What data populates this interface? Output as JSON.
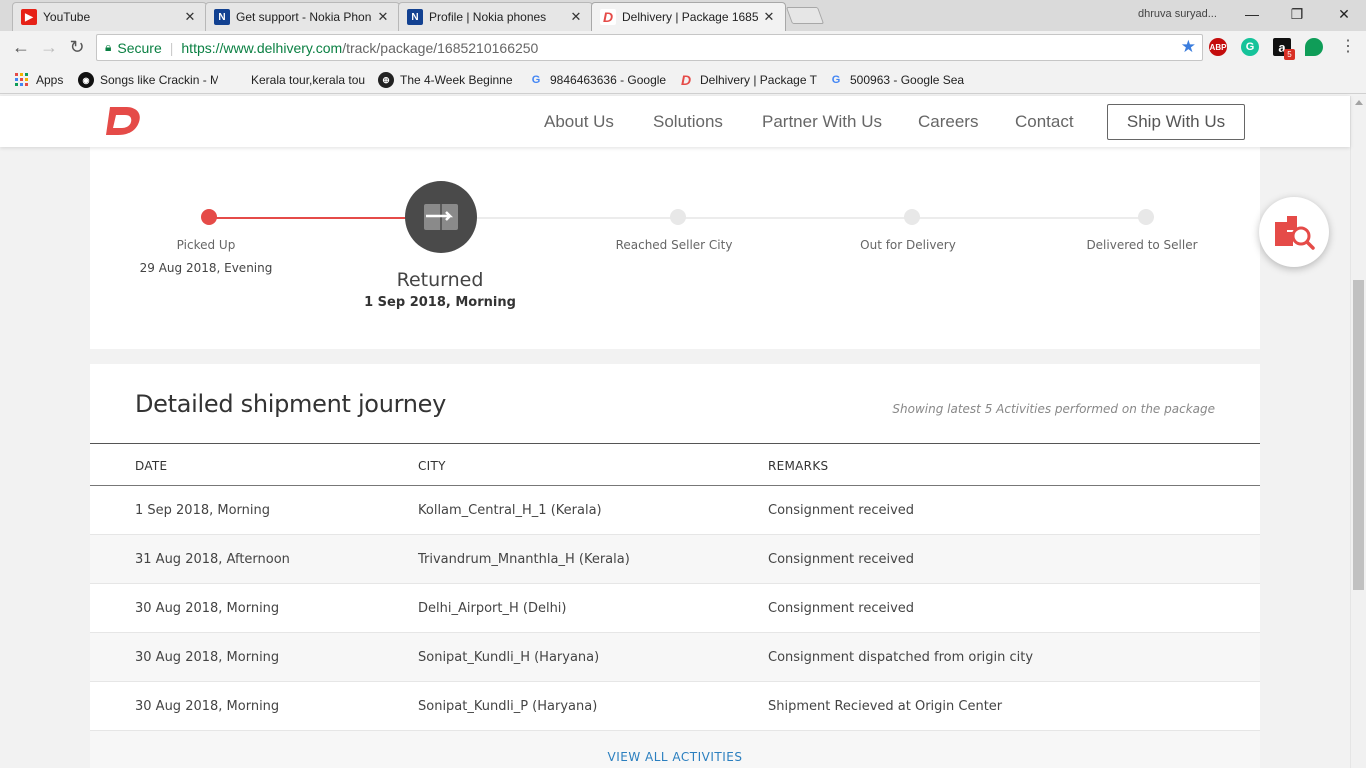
{
  "browser": {
    "tabs": [
      {
        "title": "YouTube",
        "icon": "youtube-icon",
        "color": "#e62117"
      },
      {
        "title": "Get support - Nokia Phon",
        "icon": "nokia-icon",
        "color": "#124191"
      },
      {
        "title": "Profile | Nokia phones",
        "icon": "nokia-icon",
        "color": "#124191"
      },
      {
        "title": "Delhivery | Package 1685",
        "icon": "delhivery-icon",
        "color": "#e54b48"
      }
    ],
    "profile_name": "dhruva suryad...",
    "address": {
      "secure_label": "Secure",
      "url_host": "https://www.delhivery.com",
      "url_path": "/track/package/1685210166250"
    },
    "extensions": [
      {
        "name": "adblock-icon",
        "label": "ABP",
        "color": "#c40d0d"
      },
      {
        "name": "grammarly-icon",
        "label": "G",
        "color": "#15c39a"
      },
      {
        "name": "amazon-icon",
        "label": "a",
        "color": "#111111",
        "badge": "5"
      },
      {
        "name": "hangouts-icon",
        "label": "",
        "color": "#0f9d58"
      }
    ],
    "bookmarks": [
      {
        "label": "Apps",
        "icon": "apps-grid-icon"
      },
      {
        "label": "Songs like Crackin - M",
        "icon": "music-icon"
      },
      {
        "label": "Kerala tour,kerala tou",
        "icon": "blank-page-icon"
      },
      {
        "label": "The 4-Week Beginne",
        "icon": "fitness-icon"
      },
      {
        "label": "9846463636 - Google",
        "icon": "google-icon"
      },
      {
        "label": "Delhivery | Package T",
        "icon": "delhivery-icon"
      },
      {
        "label": "500963 - Google Sea",
        "icon": "google-icon"
      }
    ]
  },
  "site": {
    "nav": [
      "About Us",
      "Solutions",
      "Partner With Us",
      "Careers",
      "Contact"
    ],
    "cta": "Ship With Us",
    "brand_color": "#e54b48"
  },
  "progress": {
    "picked_up": {
      "label": "Picked Up",
      "date": "29 Aug 2018, Evening"
    },
    "current": {
      "label": "Returned",
      "date": "1 Sep 2018, Morning"
    },
    "steps": [
      "Reached Seller City",
      "Out for Delivery",
      "Delivered to Seller"
    ]
  },
  "journey": {
    "title": "Detailed shipment journey",
    "subtitle": "Showing latest 5 Activities performed on the package",
    "columns": [
      "DATE",
      "CITY",
      "REMARKS"
    ],
    "rows": [
      {
        "date": "1 Sep 2018, Morning",
        "city": "Kollam_Central_H_1 (Kerala)",
        "remarks": "Consignment received"
      },
      {
        "date": "31 Aug 2018, Afternoon",
        "city": "Trivandrum_Mnanthla_H (Kerala)",
        "remarks": "Consignment received"
      },
      {
        "date": "30 Aug 2018, Morning",
        "city": "Delhi_Airport_H (Delhi)",
        "remarks": "Consignment received"
      },
      {
        "date": "30 Aug 2018, Morning",
        "city": "Sonipat_Kundli_H (Haryana)",
        "remarks": "Consignment dispatched from origin city"
      },
      {
        "date": "30 Aug 2018, Morning",
        "city": "Sonipat_Kundli_P (Haryana)",
        "remarks": "Shipment Recieved at Origin Center"
      }
    ],
    "view_all": "VIEW ALL ACTIVITIES"
  }
}
